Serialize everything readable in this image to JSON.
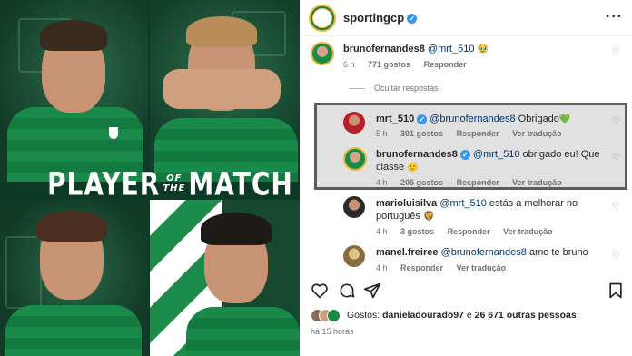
{
  "post_image": {
    "banner_line1": "PLAYER",
    "banner_of": "OF",
    "banner_the": "THE",
    "banner_line2": "MATCH"
  },
  "header": {
    "account": "sportingcp",
    "more_icon": "more-horizontal-icon"
  },
  "comments": [
    {
      "user": "brunofernandes8",
      "mention": "@mrt_510",
      "text": " ",
      "emoji": "🥹",
      "time": "6 h",
      "likes": "771 gostos",
      "reply": "Responder"
    },
    {
      "hide_replies": "Ocultar respostas"
    },
    {
      "user": "mrt_510",
      "verified": true,
      "mention": "@brunofernandes8",
      "text": " Obrigado",
      "emoji": "💚",
      "time": "5 h",
      "likes": "301 gostos",
      "reply": "Responder",
      "translate": "Ver tradução"
    },
    {
      "user": "brunofernandes8",
      "verified": true,
      "mention": "@mrt_510",
      "text": " obrigado eu! Que",
      "text2": "classe",
      "emoji": "🫡",
      "time": "4 h",
      "likes": "205 gostos",
      "reply": "Responder",
      "translate": "Ver tradução"
    },
    {
      "user": "marioluisilva",
      "mention": "@mrt_510",
      "text": " estás a melhorar no",
      "text2": "português",
      "emoji": "🦁",
      "time": "4 h",
      "likes": "3 gostos",
      "reply": "Responder",
      "translate": "Ver tradução"
    },
    {
      "user": "manel.freiree",
      "mention": "@brunofernandes8",
      "text": " amo te bruno",
      "time": "4 h",
      "reply": "Responder",
      "translate": "Ver tradução"
    }
  ],
  "actions": {
    "like_icon": "heart-icon",
    "comment_icon": "comment-icon",
    "share_icon": "send-icon",
    "save_icon": "bookmark-icon"
  },
  "likes_summary": {
    "prefix": "Gostos: ",
    "user": "danieladourado97",
    "middle": " e ",
    "others": "26 671 outras pessoas"
  },
  "time_ago": "há 15 horas",
  "colors": {
    "sporting_green": "#1a8a4a",
    "verified_blue": "#3897f0",
    "mention_blue": "#00376b",
    "meta_grey": "#737373"
  }
}
